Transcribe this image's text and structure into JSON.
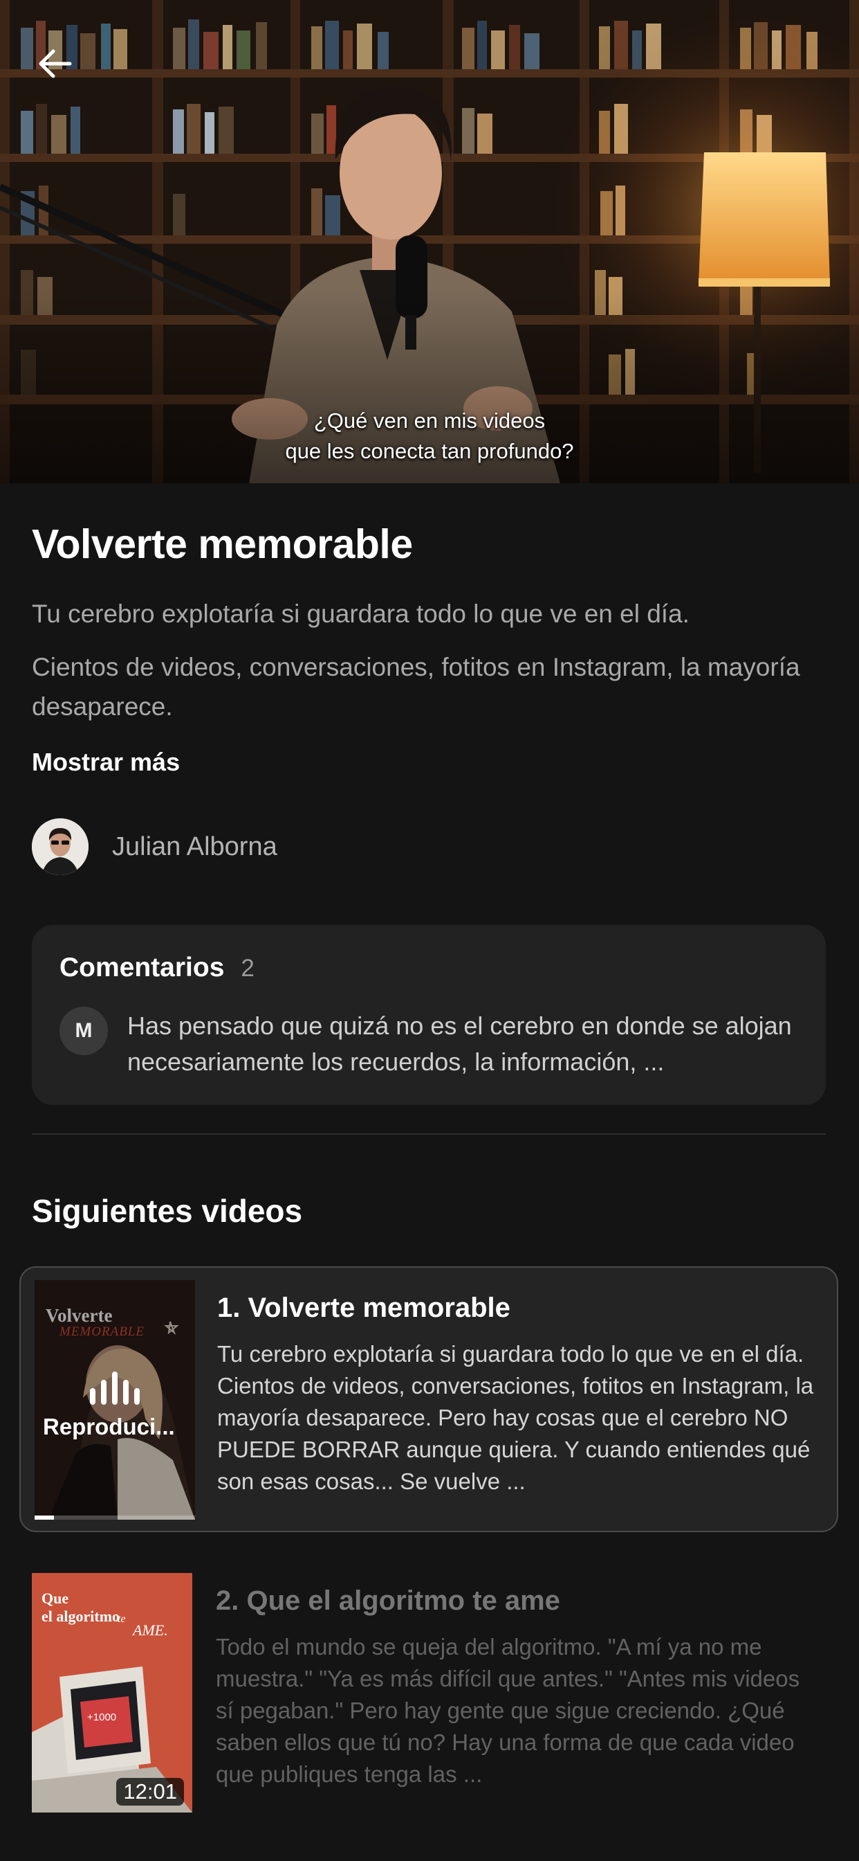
{
  "hero": {
    "subtitle_line1": "¿Qué ven en mis videos",
    "subtitle_line2": "que les conecta tan profundo?",
    "back_icon": "arrow-left-icon"
  },
  "video": {
    "title": "Volverte memorable",
    "desc1": "Tu cerebro explotaría si guardara todo lo que ve en el día.",
    "desc2": "Cientos de videos, conversaciones, fotitos en Instagram, la mayoría desaparece.",
    "show_more": "Mostrar más"
  },
  "author": {
    "name": "Julian Alborna"
  },
  "comments": {
    "title": "Comentarios",
    "count": "2",
    "first_initial": "M",
    "first_text": "Has pensado que quizá no es el cerebro en donde se alojan necesariamente los recuerdos, la información, ..."
  },
  "next_section": {
    "title": "Siguientes videos",
    "items": [
      {
        "title": "1. Volverte memorable",
        "description": "Tu cerebro explotaría si guardara todo lo que ve en el día. Cientos de videos, conversaciones, fotitos en Instagram, la mayoría desaparece. Pero hay cosas que el cerebro NO PUEDE BORRAR aunque quiera. Y cuando entiendes qué son esas cosas... Se vuelve ...",
        "status": "Reproduci...",
        "thumb_line1": "Volverte",
        "thumb_line2": "MEMORABLE",
        "progress": 0.12
      },
      {
        "title": "2. Que el algoritmo te ame",
        "description": "Todo el mundo se queja del algoritmo. \"A mí ya no me muestra.\" \"Ya es más difícil que antes.\" \"Antes mis videos sí pegaban.\" Pero hay gente que sigue creciendo. ¿Qué saben ellos que tú no? Hay una forma de que cada video que publiques tenga las ...",
        "duration": "12:01",
        "thumb_line1": "Que",
        "thumb_line2": "el algoritmo",
        "thumb_line3": "te",
        "thumb_line4": "AME.",
        "screen_text": "+1000"
      }
    ]
  },
  "colors": {
    "background": "#141414",
    "card": "#222222",
    "muted_text": "#a9a9a9",
    "thumb2_bg": "#d2543a"
  }
}
